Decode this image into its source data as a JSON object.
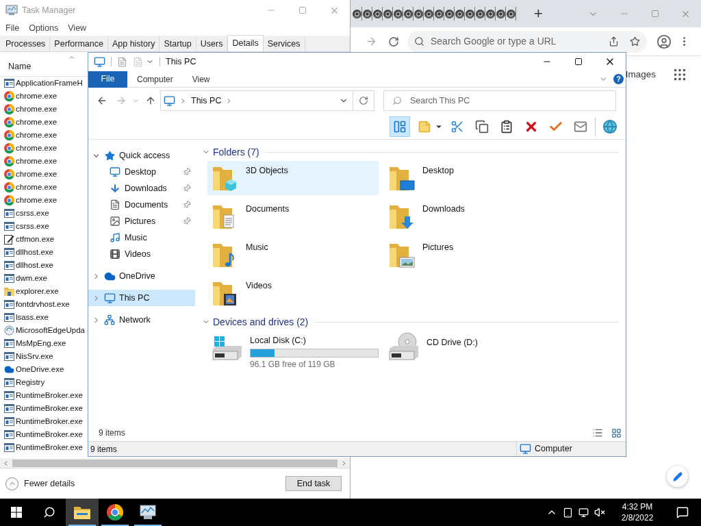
{
  "browser": {
    "new_tab": "+",
    "omnibox_placeholder": "Search Google or type a URL",
    "link": "Images"
  },
  "task_manager": {
    "title": "Task Manager",
    "menu": [
      "File",
      "Options",
      "View"
    ],
    "tabs": [
      {
        "label": "Processes",
        "selected": false
      },
      {
        "label": "Performance",
        "selected": false
      },
      {
        "label": "App history",
        "selected": false
      },
      {
        "label": "Startup",
        "selected": false
      },
      {
        "label": "Users",
        "selected": false
      },
      {
        "label": "Details",
        "selected": true
      },
      {
        "label": "Services",
        "selected": false
      }
    ],
    "column": "Name",
    "rows": [
      {
        "name": "ApplicationFrameH",
        "kind": "app"
      },
      {
        "name": "chrome.exe",
        "kind": "chrome"
      },
      {
        "name": "chrome.exe",
        "kind": "chrome"
      },
      {
        "name": "chrome.exe",
        "kind": "chrome"
      },
      {
        "name": "chrome.exe",
        "kind": "chrome"
      },
      {
        "name": "chrome.exe",
        "kind": "chrome"
      },
      {
        "name": "chrome.exe",
        "kind": "chrome"
      },
      {
        "name": "chrome.exe",
        "kind": "chrome"
      },
      {
        "name": "chrome.exe",
        "kind": "chrome"
      },
      {
        "name": "chrome.exe",
        "kind": "chrome"
      },
      {
        "name": "csrss.exe",
        "kind": "app"
      },
      {
        "name": "csrss.exe",
        "kind": "app"
      },
      {
        "name": "ctfmon.exe",
        "kind": "pen"
      },
      {
        "name": "dllhost.exe",
        "kind": "app"
      },
      {
        "name": "dllhost.exe",
        "kind": "app"
      },
      {
        "name": "dwm.exe",
        "kind": "app"
      },
      {
        "name": "explorer.exe",
        "kind": "folder"
      },
      {
        "name": "fontdrvhost.exe",
        "kind": "app"
      },
      {
        "name": "lsass.exe",
        "kind": "app"
      },
      {
        "name": "MicrosoftEdgeUpda",
        "kind": "update"
      },
      {
        "name": "MsMpEng.exe",
        "kind": "app"
      },
      {
        "name": "NisSrv.exe",
        "kind": "app"
      },
      {
        "name": "OneDrive.exe",
        "kind": "cloud"
      },
      {
        "name": "Registry",
        "kind": "app"
      },
      {
        "name": "RuntimeBroker.exe",
        "kind": "app"
      },
      {
        "name": "RuntimeBroker.exe",
        "kind": "app"
      },
      {
        "name": "RuntimeBroker.exe",
        "kind": "app"
      },
      {
        "name": "RuntimeBroker.exe",
        "kind": "app"
      },
      {
        "name": "RuntimeBroker.exe",
        "kind": "app"
      }
    ],
    "fewer_details": "Fewer details",
    "end_task": "End task"
  },
  "explorer": {
    "title": "This PC",
    "help": "?",
    "ribbon_tabs": [
      {
        "label": "File",
        "kind": "file_menu"
      },
      {
        "label": "Computer",
        "kind": "tab"
      },
      {
        "label": "View",
        "kind": "tab"
      }
    ],
    "address": "This PC",
    "search_placeholder": "Search This PC",
    "toolbar": [
      {
        "kind": "pane",
        "on": true
      },
      {
        "kind": "note",
        "on": false
      },
      {
        "kind": "cut",
        "on": false
      },
      {
        "kind": "copy",
        "on": false
      },
      {
        "kind": "paste",
        "on": false
      },
      {
        "kind": "delete",
        "on": false
      },
      {
        "kind": "check",
        "on": false
      },
      {
        "kind": "mail",
        "on": false
      },
      {
        "kind": "globe",
        "on": false
      }
    ],
    "nav": [
      {
        "label": "Quick access",
        "kind": "star",
        "expanded": true,
        "selected": false,
        "children": [
          {
            "label": "Desktop",
            "kind": "desktop",
            "pinned": true,
            "selected": false
          },
          {
            "label": "Downloads",
            "kind": "downloads",
            "pinned": true,
            "selected": false
          },
          {
            "label": "Documents",
            "kind": "documents",
            "pinned": true,
            "selected": false
          },
          {
            "label": "Pictures",
            "kind": "pictures",
            "pinned": true,
            "selected": false
          },
          {
            "label": "Music",
            "kind": "music",
            "pinned": false,
            "selected": false
          },
          {
            "label": "Videos",
            "kind": "videos",
            "pinned": false,
            "selected": false
          }
        ]
      },
      {
        "label": "OneDrive",
        "kind": "cloud",
        "expanded": false,
        "selected": false
      },
      {
        "label": "This PC",
        "kind": "pc",
        "expanded": false,
        "selected": true
      },
      {
        "label": "Network",
        "kind": "network",
        "expanded": false,
        "selected": false
      }
    ],
    "sections": [
      {
        "title": "Folders (7)",
        "expanded": true,
        "items": [
          {
            "name": "3D Objects",
            "kind": "objects",
            "selected": true
          },
          {
            "name": "Desktop",
            "kind": "desktop",
            "selected": false
          },
          {
            "name": "Documents",
            "kind": "documents",
            "selected": false
          },
          {
            "name": "Downloads",
            "kind": "downloads",
            "selected": false
          },
          {
            "name": "Music",
            "kind": "music",
            "selected": false
          },
          {
            "name": "Pictures",
            "kind": "pictures",
            "selected": false
          },
          {
            "name": "Videos",
            "kind": "videos",
            "selected": false
          }
        ]
      },
      {
        "title": "Devices and drives (2)",
        "expanded": true,
        "items": [
          {
            "name": "Local Disk (C:)",
            "kind": "disk",
            "selected": false,
            "level": 0.19,
            "detail": "96.1 GB free of 119 GB"
          },
          {
            "name": "CD Drive (D:)",
            "kind": "cd",
            "selected": false
          }
        ]
      }
    ],
    "item_count": "9 items",
    "status_bar": {
      "count": "9 items",
      "location": "Computer"
    }
  },
  "taskbar": {
    "apps": [
      {
        "kind": "explorer",
        "selected": true,
        "running": true
      },
      {
        "kind": "chrome",
        "selected": false,
        "running": true
      },
      {
        "kind": "taskmgr",
        "selected": false,
        "running": true
      }
    ],
    "time": "4:32 PM",
    "date": "2/8/2022"
  }
}
